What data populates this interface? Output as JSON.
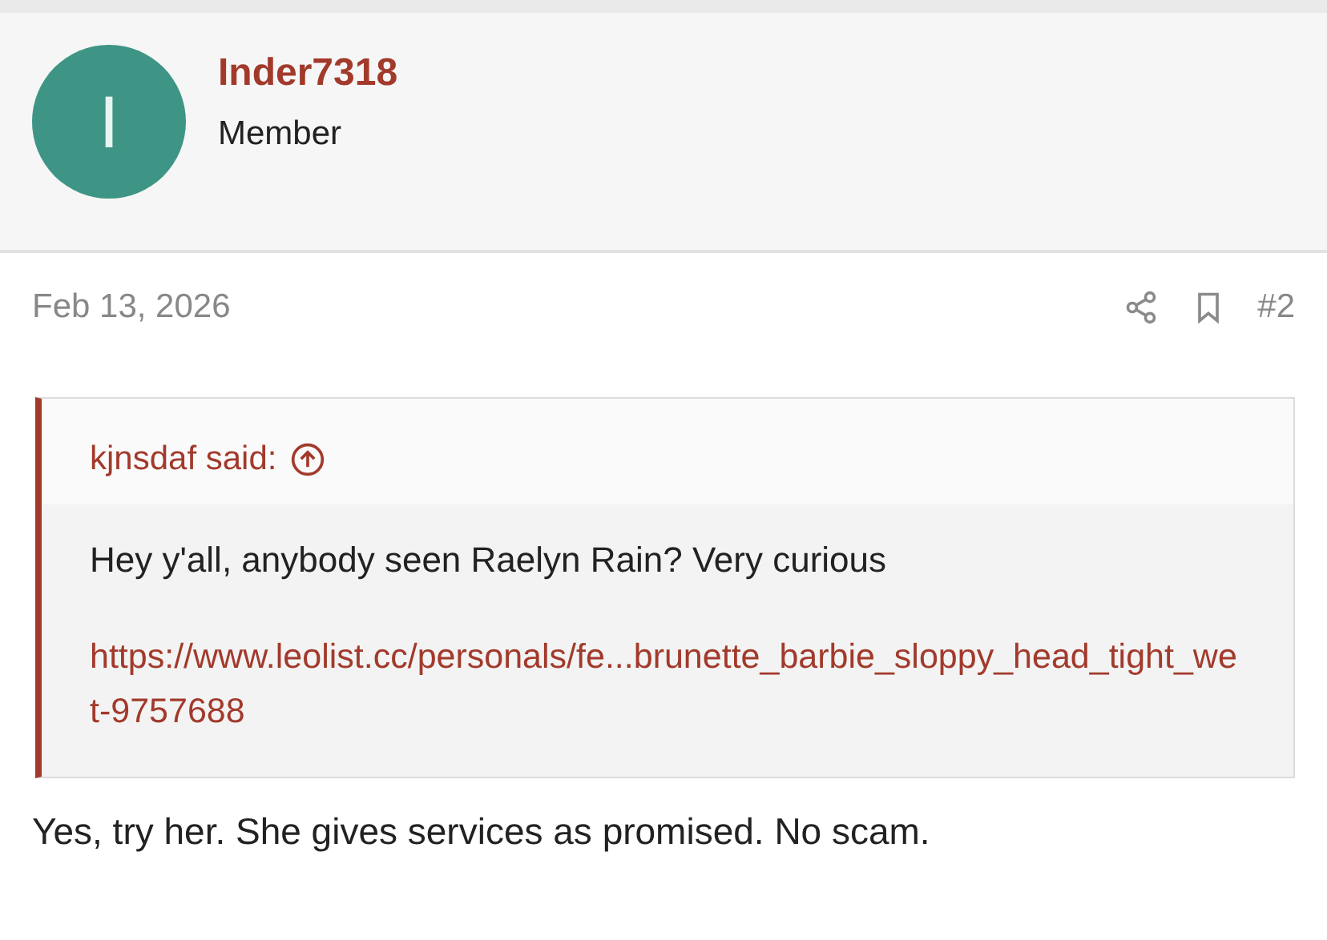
{
  "author": {
    "initial": "I",
    "name": "Inder7318",
    "role": "Member"
  },
  "post": {
    "date": "Feb 13, 2026",
    "number": "#2",
    "quote": {
      "attribution": "kjnsdaf said:",
      "text": "Hey y'all, anybody seen Raelyn Rain? Very curious",
      "link": "https://www.leolist.cc/personals/fe...brunette_barbie_sloppy_head_tight_wet-9757688"
    },
    "body": "Yes, try her. She gives services as promised. No scam."
  }
}
